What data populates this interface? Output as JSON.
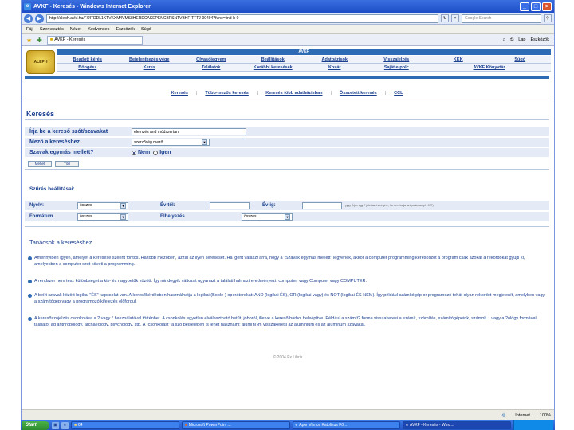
{
  "window": {
    "title": "AVKF - Keresés - Windows Internet Explorer",
    "minimize": "_",
    "maximize": "□",
    "close": "×"
  },
  "address": {
    "url": "http://aleph.avkf.hu/F/JITDDL1KTVKXM4VMS8HERDCAKEPENCBPSNTVBHF-TTTJ-00494?func=find-b-0",
    "search_placeholder": "Google Search"
  },
  "menubar": {
    "items": [
      "Fájl",
      "Szerkesztés",
      "Nézet",
      "Kedvencek",
      "Eszközök",
      "Súgó"
    ]
  },
  "tab": {
    "label": "AVKF - Keresés"
  },
  "toolbar_right": {
    "items": [
      "Lap",
      "Eszközök"
    ]
  },
  "banner": {
    "logo": "ALEPH",
    "bar": "AVKF"
  },
  "nav": {
    "row1": [
      "Beadott kérés",
      "Bejelentkezés vége",
      "Olvasójegyem",
      "Beállítások",
      "Adatbázisok",
      "Visszajelzés",
      "KKK",
      "Súgó"
    ],
    "row2": [
      "Böngész",
      "Keres",
      "Találatok",
      "Korábbi keresések",
      "Kosár",
      "Saját e-polc",
      "AVKF Könyvtár"
    ]
  },
  "subnav": {
    "items": [
      "Keresés",
      "Több-mezős keresés",
      "Keresés több adatbázisban",
      "Összetett keresés",
      "CCL"
    ]
  },
  "page": {
    "title": "Keresés"
  },
  "form": {
    "term_label": "Írja be a kereső szót/szavakat",
    "term_value": "elemzés and módszertan",
    "field_label": "Mező a kereséshez",
    "field_value": "szerzőség mező",
    "adjacent_label": "Szavak egymás mellett?",
    "adjacent_no": "Nem",
    "adjacent_yes": "Igen",
    "ok_button": "Mehet",
    "clear_button": "Törl"
  },
  "filters": {
    "title": "Szűrés beállításai:",
    "language_label": "Nyelv:",
    "language_value": "összes",
    "year_from_label": "Év-től:",
    "year_to_label": "Év-ig:",
    "year_hint": "yyyy (Írjon egy ? jelet az év végére, ha nem tudja azt pontosan pl 19??)",
    "format_label": "Formátum",
    "format_value": "összes",
    "location_label": "Elhelyezés",
    "location_value": "összes"
  },
  "tips": {
    "title": "Tanácsok a kereséshez",
    "items": [
      "Amennyiben ígyen, amelyet a keresése szerint fontos. Ha több mezőben, azzal az ilyen keresését. Ha igent választ arra, hogy a \"Szavak egymás mellett\" legyenek, akkor a computer programming keresőszót a program csak azokat a rekordokat gyűjti ki, amelyekben a computer szót követi a programming.",
      "A rendszer nem tesz különbséget a kis- és nagybetűk között. Így mindegyik változat ugyanazt a találati halmazt eredményezi: computer, vagy Computer vagy COMPUTER.",
      "A beírt szavak között logikai \"ÉS\" kapcsolat van. A keresőkérdésben használhatja a logikai (Boole-) operátorokat: AND (logikai ÉS), OR (logikai vagy) és NOT (logikai ÉS NEM). Így például számítógép or programozó tehát olyan rekordot megjelenít, amelyben vagy a számítógép vagy a programozó kifejezés előfordul.",
      "A keresőszójelzés csonkolása a ? vagy * használatával történhet. A csonkolás egyetlen elválasztható betűt, jobbról, illetve a kereső bárhol beleépítve. Például a számít? forma visszakeresi a számít, számítás, számítógépeink, számolt... vagy a ?ológy formával találatot ad anthropology, archaeology, psychology, stb. A \"csonkolást\" a szó belsejében is lehet használni: alumíni?m visszakeresi az aluminium és az aluminum szavakat."
    ]
  },
  "footer": {
    "text": "© 2004 Ex Libris"
  },
  "status": {
    "left": "",
    "zone": "Internet",
    "zoom": "100%"
  },
  "taskbar": {
    "start": "Start",
    "items": [
      "04",
      "Microsoft PowerPoint ...",
      "Apor Vilmos Katolikus Fő...",
      "AVKF - Keresés - Wind..."
    ],
    "clock": ""
  }
}
